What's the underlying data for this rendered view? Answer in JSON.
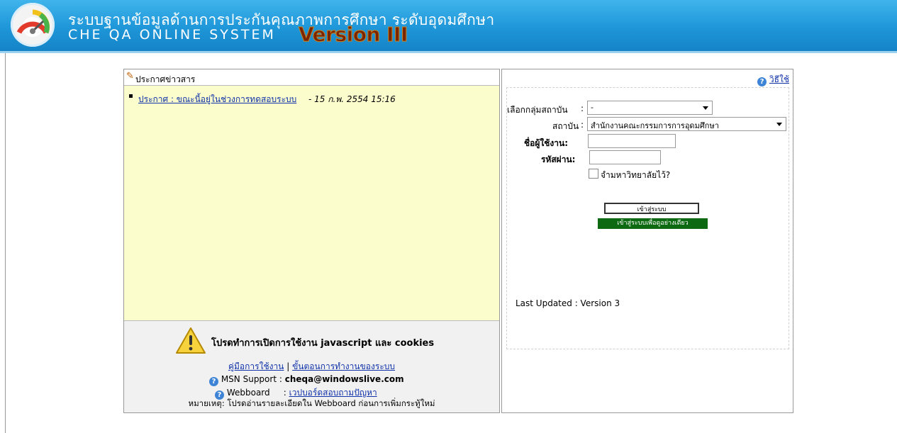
{
  "header": {
    "title_th": "ระบบฐานข้อมูลด้านการประกันคุณภาพการศึกษา ระดับอุดมศึกษา",
    "title_en": "CHE QA ONLINE SYSTEM",
    "version": "Version III"
  },
  "news": {
    "heading": "ประกาศข่าวสาร",
    "items": [
      {
        "link": "ประกาศ   : ขณะนี้อยู่ในช่วงการทดสอบระบบ",
        "date": "- 15 ก.พ. 2554 15:16"
      }
    ]
  },
  "notice": {
    "warning": "โปรดทำการเปิดการใช้งาน  javascript และ  cookies",
    "manual_link": "คู่มือการใช้งาน",
    "separator": "|",
    "steps_link": "ขั้นตอนการทำงานของระบบ",
    "msn_label": "MSN Support :",
    "msn_value": "cheqa@windowslive.com",
    "webboard_label": "Webboard",
    "webboard_colon": ":",
    "webboard_link": "เวปบอร์ดสอบถามปัญหา",
    "note": "หมายเหตุ: โปรดอ่านรายละเอียดใน  Webboard ก่อนการเพิ่มกระทู้ใหม่"
  },
  "login": {
    "how_to": "วิธีใช้",
    "group_label": "เลือกกลุ่มสถาบัน",
    "group_value": "-",
    "institute_label": "สถาบัน",
    "institute_value": "สำนักงานคณะกรรมการการอุดมศึกษา",
    "colon": ":",
    "username_label": "ชื่อผู้ใช้งาน:",
    "password_label": "รหัสผ่าน:",
    "remember_label": "จำมหาวิทยาลัยไว้?",
    "login_button": "เข้าสู่ระบบ",
    "guest_button": "เข้าสู่ระบบเพื่อดูอย่างเดียว",
    "last_updated": "Last Updated : Version 3"
  },
  "colors": {
    "header_blue": "#1e96d8",
    "news_bg": "#fbfdcc",
    "guest_green": "#0e6a12",
    "link": "#1133aa"
  }
}
